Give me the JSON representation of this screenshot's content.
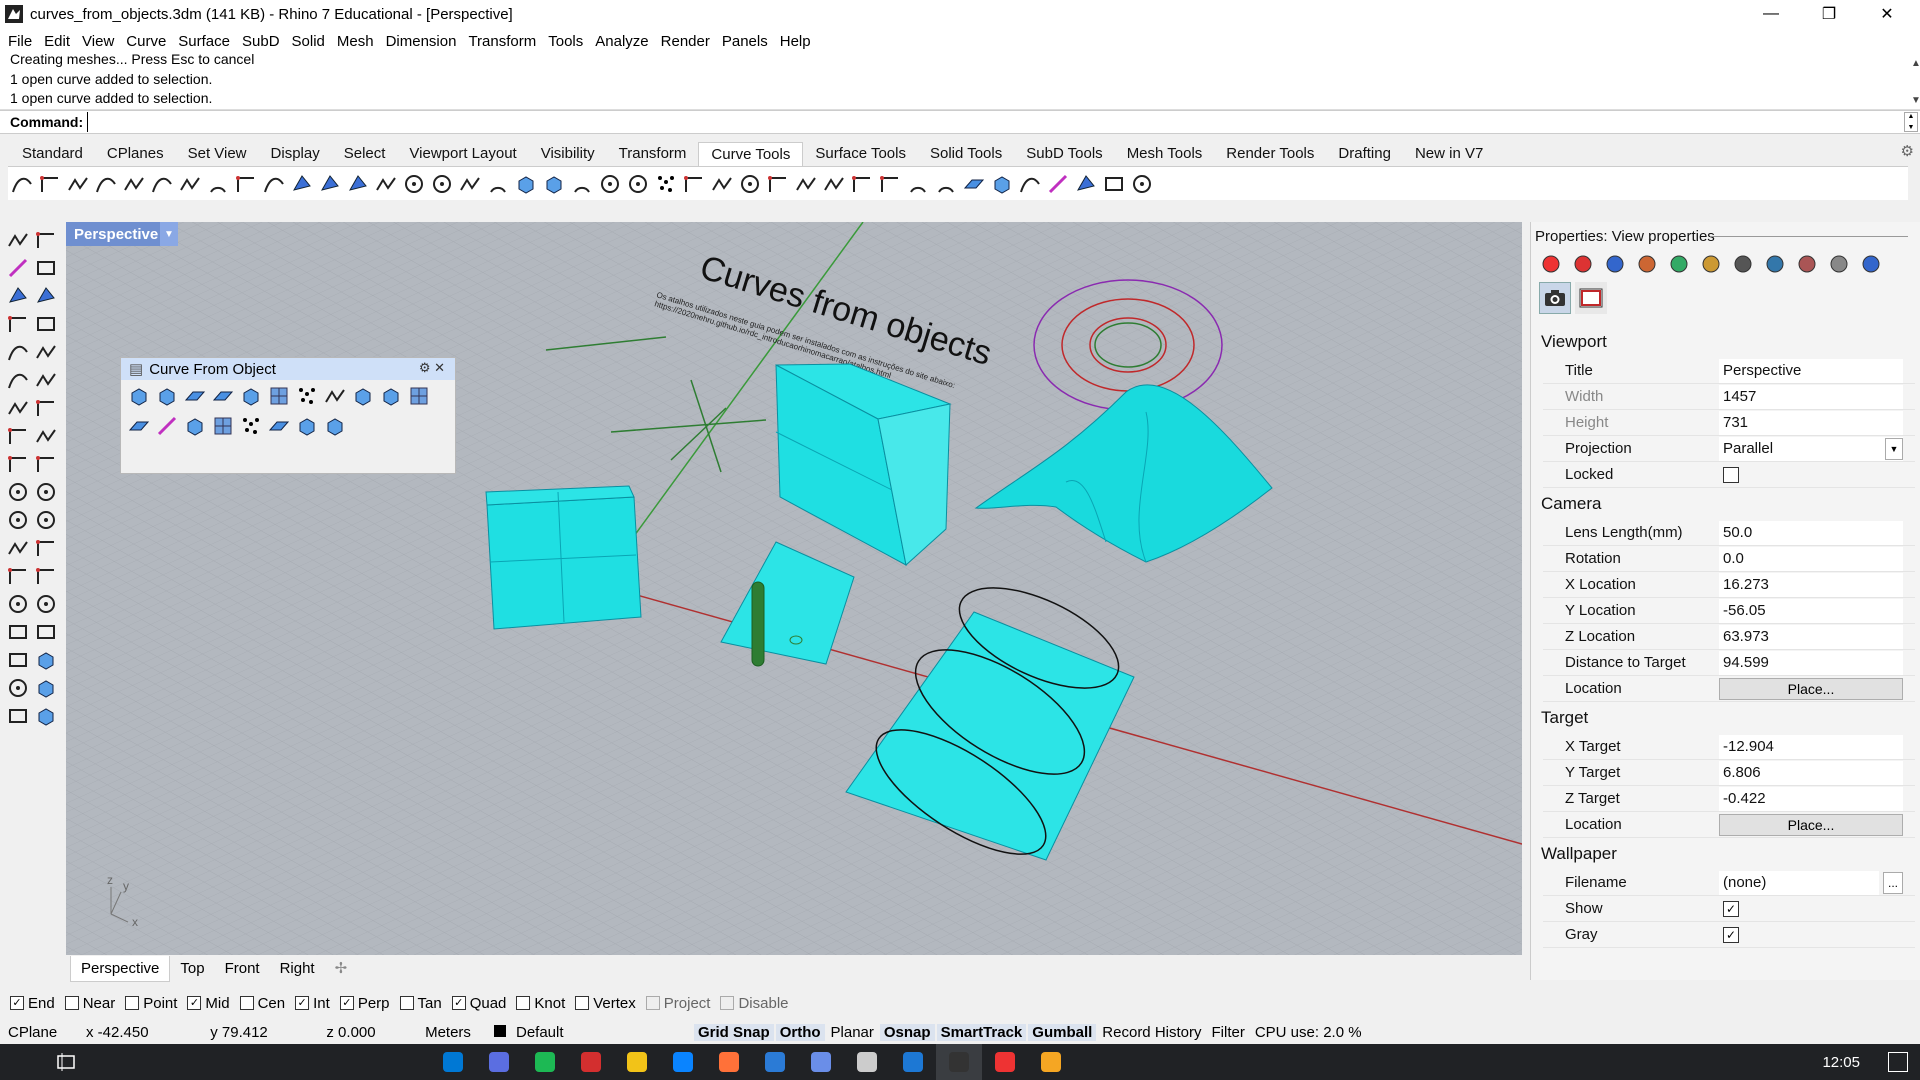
{
  "window": {
    "title": "curves_from_objects.3dm (141 KB) - Rhino 7 Educational - [Perspective]"
  },
  "menu": [
    "File",
    "Edit",
    "View",
    "Curve",
    "Surface",
    "SubD",
    "Solid",
    "Mesh",
    "Dimension",
    "Transform",
    "Tools",
    "Analyze",
    "Render",
    "Panels",
    "Help"
  ],
  "history": [
    "Creating meshes... Press Esc to cancel",
    "1 open curve added to selection.",
    "1 open curve added to selection."
  ],
  "command": {
    "label": "Command:",
    "value": ""
  },
  "toolbar_tabs": [
    "Standard",
    "CPlanes",
    "Set View",
    "Display",
    "Select",
    "Viewport Layout",
    "Visibility",
    "Transform",
    "Curve Tools",
    "Surface Tools",
    "Solid Tools",
    "SubD Tools",
    "Mesh Tools",
    "Render Tools",
    "Drafting",
    "New in V7"
  ],
  "active_toolbar_tab": "Curve Tools",
  "viewport": {
    "title": "Perspective",
    "scene_title": "Curves from objects",
    "scene_subtitle_line1": "Os atalhos utilizados neste guia podem ser instalados com as instruções do site abaixo:",
    "scene_subtitle_line2": "https://2020nehru.github.io/rdc_introducaorhinomacarrao/atalhos.html",
    "axis_labels": {
      "z": "z",
      "y": "y",
      "x": "x"
    }
  },
  "floating_panel": {
    "title": "Curve From Object"
  },
  "viewport_tabs": [
    "Perspective",
    "Top",
    "Front",
    "Right"
  ],
  "osnaps": [
    {
      "label": "End",
      "checked": true
    },
    {
      "label": "Near",
      "checked": false
    },
    {
      "label": "Point",
      "checked": false
    },
    {
      "label": "Mid",
      "checked": true
    },
    {
      "label": "Cen",
      "checked": false
    },
    {
      "label": "Int",
      "checked": true
    },
    {
      "label": "Perp",
      "checked": true
    },
    {
      "label": "Tan",
      "checked": false
    },
    {
      "label": "Quad",
      "checked": true
    },
    {
      "label": "Knot",
      "checked": false
    },
    {
      "label": "Vertex",
      "checked": false
    },
    {
      "label": "Project",
      "checked": false,
      "disabled": true
    },
    {
      "label": "Disable",
      "checked": false,
      "disabled": true
    }
  ],
  "status": {
    "cplane": "CPlane",
    "x": "x -42.450",
    "y": "y 79.412",
    "z": "z 0.000",
    "units": "Meters",
    "layer": "Default",
    "toggles": [
      "Grid Snap",
      "Ortho",
      "Planar",
      "Osnap",
      "SmartTrack",
      "Gumball",
      "Record History",
      "Filter"
    ],
    "cpu": "CPU use: 2.0 %"
  },
  "properties": {
    "header": "Properties: View properties",
    "viewport_section": "Viewport",
    "camera_section": "Camera",
    "target_section": "Target",
    "wallpaper_section": "Wallpaper",
    "title_label": "Title",
    "title_value": "Perspective",
    "width_label": "Width",
    "width_value": "1457",
    "height_label": "Height",
    "height_value": "731",
    "projection_label": "Projection",
    "projection_value": "Parallel",
    "locked_label": "Locked",
    "lens_label": "Lens Length(mm)",
    "lens_value": "50.0",
    "rotation_label": "Rotation",
    "rotation_value": "0.0",
    "xloc_label": "X Location",
    "xloc_value": "16.273",
    "yloc_label": "Y Location",
    "yloc_value": "-56.05",
    "zloc_label": "Z Location",
    "zloc_value": "63.973",
    "dist_label": "Distance to Target",
    "dist_value": "94.599",
    "location_label": "Location",
    "place_button": "Place...",
    "xt_label": "X Target",
    "xt_value": "-12.904",
    "yt_label": "Y Target",
    "yt_value": "6.806",
    "zt_label": "Z Target",
    "zt_value": "-0.422",
    "tloc_label": "Location",
    "filename_label": "Filename",
    "filename_value": "(none)",
    "browse_button": "...",
    "show_label": "Show",
    "gray_label": "Gray"
  },
  "taskbar": {
    "time": "12:05"
  },
  "colors": {
    "cyan": "#00e5e8",
    "viewport_bg": "#b3b8bf",
    "viewport_title": "#6f8fd0",
    "taskbar": "#202225"
  }
}
